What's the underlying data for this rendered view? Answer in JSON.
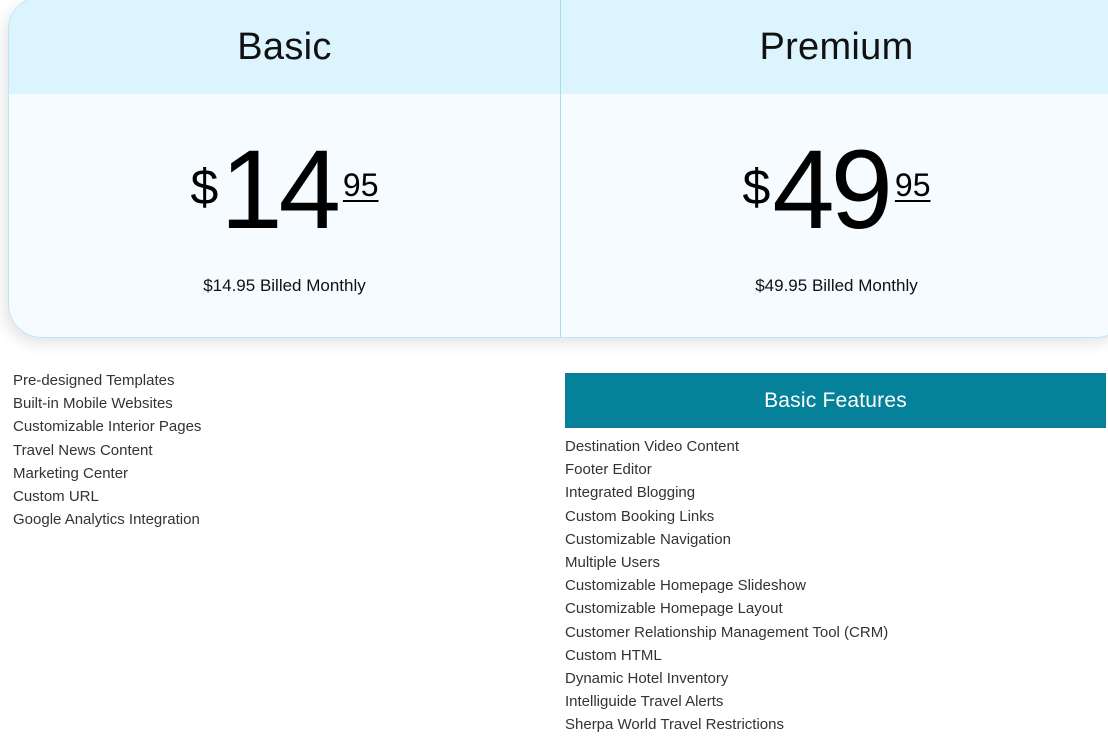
{
  "plans": [
    {
      "name": "Basic",
      "price": {
        "currency": "$",
        "whole": "14",
        "cents": "95"
      },
      "billing": "$14.95 Billed Monthly"
    },
    {
      "name": "Premium",
      "price": {
        "currency": "$",
        "whole": "49",
        "cents": "95"
      },
      "billing": "$49.95 Billed Monthly"
    }
  ],
  "basic_features": [
    "Pre-designed Templates",
    "Built-in Mobile Websites",
    "Customizable Interior Pages",
    "Travel News Content",
    "Marketing Center",
    "Custom URL",
    "Google Analytics Integration"
  ],
  "premium_section": {
    "header": "Basic Features",
    "features": [
      "Destination Video Content",
      "Footer Editor",
      "Integrated Blogging",
      "Custom Booking Links",
      "Customizable Navigation",
      "Multiple Users",
      "Customizable Homepage Slideshow",
      "Customizable Homepage Layout",
      "Customer Relationship Management Tool (CRM)",
      "Custom HTML",
      "Dynamic Hotel Inventory",
      "Intelliguide Travel Alerts",
      "Sherpa World Travel Restrictions"
    ]
  },
  "colors": {
    "header_bg": "#dbf4fd",
    "card_bg": "#f5fbff",
    "card_border": "#bfe6f5",
    "section_header_bg": "#05829a",
    "section_header_text": "#ffffff",
    "feature_text": "#333333"
  }
}
